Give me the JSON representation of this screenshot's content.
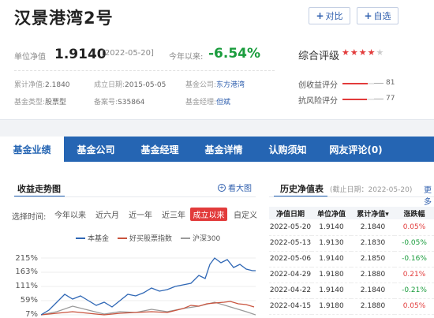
{
  "header": {
    "fund_name": "汉景港湾2号",
    "compare_label": "对比",
    "watch_label": "自选",
    "nav_label": "单位净值",
    "nav_value": "1.9140",
    "nav_date": "[2022-05-20]",
    "since_label": "今年以来:",
    "since_value": "-6.54%",
    "rating_label": "综合评级",
    "stars": 4,
    "stars_max": 5
  },
  "info": {
    "cum_nav_label": "累计净值:",
    "cum_nav_value": "2.1840",
    "est_date_label": "成立日期:",
    "est_date_value": "2015-05-05",
    "company_label": "基金公司:",
    "company_value": "东方港湾",
    "type_label": "基金类型:",
    "type_value": "股票型",
    "record_label": "备案号:",
    "record_value": "S35864",
    "manager_label": "基金经理:",
    "manager_value": "但斌"
  },
  "scores": [
    {
      "label": "创收益评分",
      "value": "81",
      "fraction": 0.81
    },
    {
      "label": "抗风险评分",
      "value": "77",
      "fraction": 0.77
    }
  ],
  "tabs": [
    "基金业绩",
    "基金公司",
    "基金经理",
    "基金详情",
    "认购须知",
    "网友评论(0)"
  ],
  "trend": {
    "title": "收益走势图",
    "zoom_label": "看大图",
    "period_label": "选择时间:",
    "periods": [
      "今年以来",
      "近六月",
      "近一年",
      "近三年",
      "成立以来",
      "自定义"
    ],
    "active_period": "成立以来",
    "legend": [
      "本基金",
      "好买股票指数",
      "沪深300"
    ],
    "y_ticks": [
      "215%",
      "163%",
      "111%",
      "59%",
      "7%"
    ]
  },
  "history": {
    "title": "历史净值表",
    "subtitle": "(截止日期：2022-05-20)",
    "more": "更多",
    "columns": [
      "净值日期",
      "单位净值",
      "累计净值▾",
      "涨跌幅"
    ],
    "rows": [
      [
        "2022-05-20",
        "1.9140",
        "2.1840",
        "0.05%"
      ],
      [
        "2022-05-13",
        "1.9130",
        "2.1830",
        "-0.05%"
      ],
      [
        "2022-05-06",
        "1.9140",
        "2.1850",
        "-0.16%"
      ],
      [
        "2022-04-29",
        "1.9180",
        "2.1880",
        "0.21%"
      ],
      [
        "2022-04-22",
        "1.9140",
        "2.1840",
        "-0.21%"
      ],
      [
        "2022-04-15",
        "1.9180",
        "2.1880",
        "0.05%"
      ]
    ],
    "row_dir": [
      "up",
      "down",
      "down",
      "up",
      "down",
      "up"
    ]
  },
  "colors": {
    "fund": "#2f67b5",
    "index": "#c9533d",
    "csi300": "#9a9a9a",
    "accent": "#2565b3",
    "rise": "#e23b3b",
    "fall": "#1a9c3d"
  }
}
